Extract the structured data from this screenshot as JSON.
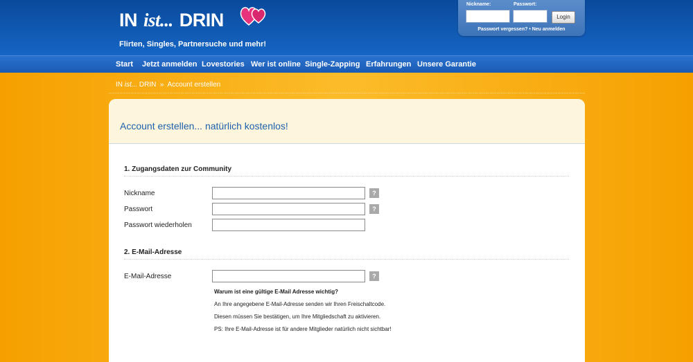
{
  "brand": {
    "logo_left": "IN",
    "logo_mid": "ist...",
    "logo_right": "DRIN",
    "tagline": "Flirten, Singles, Partnersuche und mehr!"
  },
  "login": {
    "nickname_label": "Nickname:",
    "password_label": "Passwort:",
    "button": "Login",
    "forgot_link": "Passwort vergessen?",
    "separator": "•",
    "register_link": "Neu anmelden"
  },
  "nav": {
    "items": [
      "Start",
      "Jetzt anmelden",
      "Lovestories",
      "Wer ist online",
      "Single-Zapping",
      "Erfahrungen",
      "Unsere Garantie"
    ]
  },
  "breadcrumb": {
    "home_a": "IN",
    "home_b": "ist...",
    "home_c": "DRIN",
    "sep": "»",
    "current": "Account erstellen"
  },
  "page": {
    "title": "Account erstellen... natürlich kostenlos!"
  },
  "section1": {
    "title": "1. Zugangsdaten zur Community",
    "fields": [
      {
        "label": "Nickname",
        "value": "",
        "help": "?"
      },
      {
        "label": "Passwort",
        "value": "",
        "help": "?"
      },
      {
        "label": "Passwort wiederholen",
        "value": ""
      }
    ]
  },
  "section2": {
    "title": "2. E-Mail-Adresse",
    "field": {
      "label": "E-Mail-Adresse",
      "value": "",
      "help": "?"
    },
    "info": {
      "heading": "Warum ist eine gültige E-Mail Adresse wichtig?",
      "line1": "An Ihre angegebene E-Mail-Adresse senden wir Ihren Freischaltcode.",
      "line2": "Diesen müssen Sie bestätigen, um Ihre Mitgliedschaft zu aktivieren.",
      "line3": "PS: Ihre E-Mail-Adresse ist für andere Mitglieder natürlich nicht sichtbar!"
    }
  },
  "colors": {
    "header_blue": "#0a4a9c",
    "nav_blue": "#1a5cb4",
    "background_orange": "#f6a000",
    "title_blue": "#1d5fae",
    "panel_head_cream": "#fdf6dc",
    "heart_pink": "#e8327c"
  },
  "icons": {
    "hearts": "hearts-icon",
    "help": "help-icon"
  }
}
